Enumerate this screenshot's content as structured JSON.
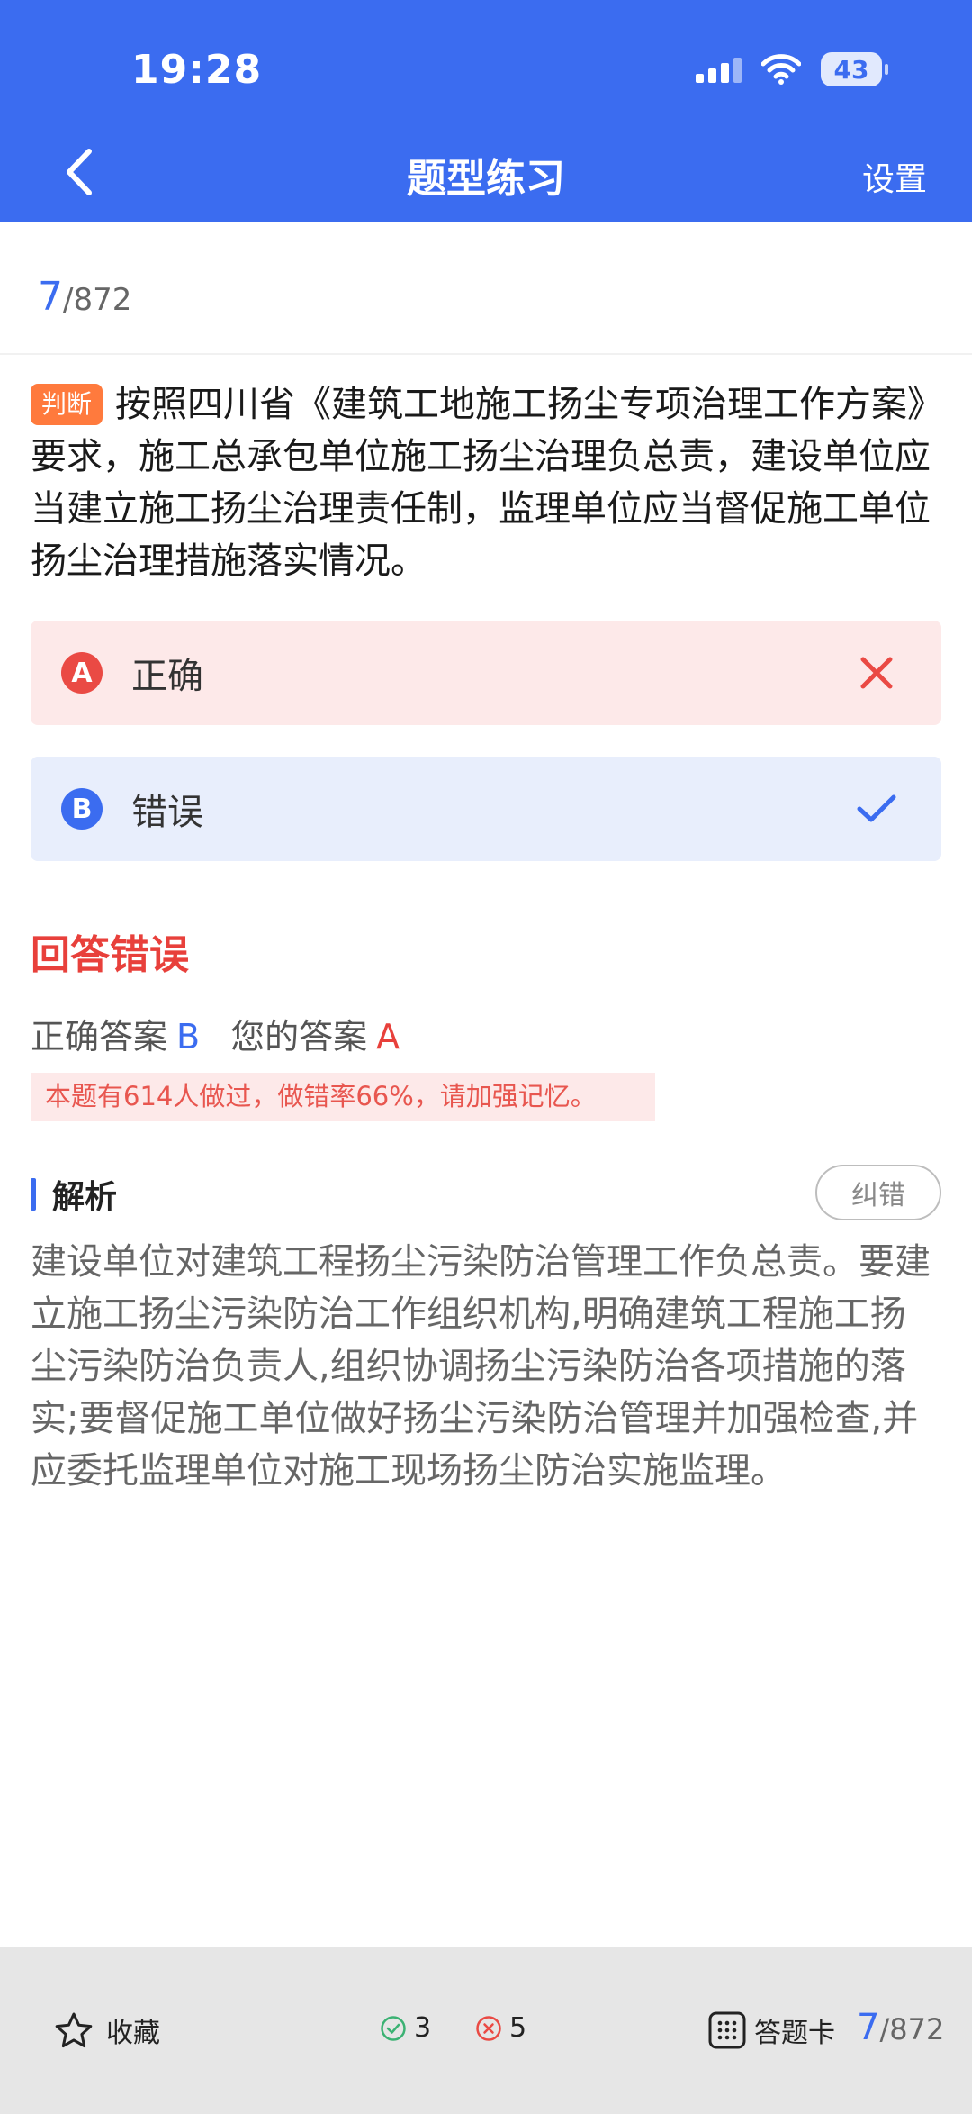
{
  "status_bar": {
    "time": "19:28",
    "battery": "43"
  },
  "header": {
    "title": "题型练习",
    "settings_label": "设置"
  },
  "progress": {
    "current": "7",
    "total": "/872"
  },
  "question": {
    "type_tag": "判断",
    "text": "按照四川省《建筑工地施工扬尘专项治理工作方案》要求，施工总承包单位施工扬尘治理负总责，建设单位应当建立施工扬尘治理责任制，监理单位应当督促施工单位扬尘治理措施落实情况。"
  },
  "options": [
    {
      "letter": "A",
      "text": "正确",
      "mark": "wrong-x-icon"
    },
    {
      "letter": "B",
      "text": "错误",
      "mark": "check-icon"
    }
  ],
  "result": {
    "title": "回答错误",
    "correct_label": "正确答案",
    "correct_value": "B",
    "your_label": "您的答案",
    "your_value": "A",
    "stat_text": "本题有614人做过，做错率66%，请加强记忆。"
  },
  "analysis": {
    "title": "解析",
    "report_label": "纠错",
    "body": "建设单位对建筑工程扬尘污染防治管理工作负总责。要建立施工扬尘污染防治工作组织机构,明确建筑工程施工扬尘污染防治负责人,组织协调扬尘污染防治各项措施的落实;要督促施工单位做好扬尘污染防治管理并加强检查,并应委托监理单位对施工现场扬尘防治实施监理。"
  },
  "bottom_bar": {
    "favorite_label": "收藏",
    "right_count": "3",
    "wrong_count": "5",
    "card_label": "答题卡",
    "current": "7",
    "total": "/872"
  },
  "colors": {
    "accent": "#3b6cf0",
    "error": "#e8403b",
    "tag": "#ff7a3d"
  }
}
